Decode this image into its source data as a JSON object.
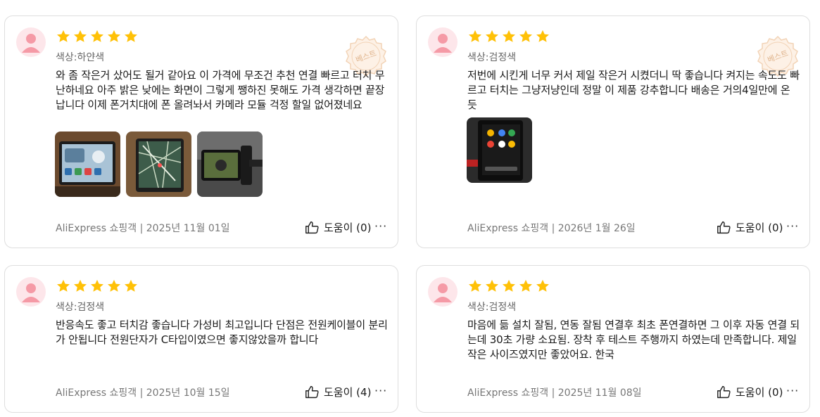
{
  "reviews": [
    {
      "stars": 5,
      "variant": "색상:하얀색",
      "text": "와 좀 작은거 샀어도 될거 같아요 이 가격에 무조건 추천 연결 빠르고 터치 무난하네요 아주 밝은 낮에는 화면이 그렇게 쨍하진 못해도 가격 생각하면 끝장납니다 이제 폰거치대에 폰 올려놔서 카메라 모듈 걱정 할일 없어졌네요",
      "badge": "베스트",
      "source": "AliExpress 쇼핑객",
      "date": "2025년 11월 01일",
      "helpful": "도움이 (0)",
      "photos": [
        "dashboard-photo-1",
        "map-photo",
        "camera-photo"
      ]
    },
    {
      "stars": 5,
      "variant": "색상:검정색",
      "text": "저번에 시킨게 너무 커서 제일 작은거 시켰더니 딱 좋습니다 켜지는 속도도 빠르고 터치는 그냥저냥인데 정말 이 제품 강추합니다 배송은 거의4일만에 온듯",
      "badge": "베스트",
      "source": "AliExpress 쇼핑객",
      "date": "2026년 1월 26일",
      "helpful": "도움이 (0)",
      "photos": [
        "apps-photo"
      ]
    },
    {
      "stars": 5,
      "variant": "색상:검정색",
      "text": "반응속도 좋고 터치감 좋습니다 가성비 최고입니다 단점은 전원케이블이 분리가 안됩니다 전원단자가 C타입이였으면 좋지않았을까 합니다",
      "source": "AliExpress 쇼핑객",
      "date": "2025년 10월 15일",
      "helpful": "도움이 (4)",
      "photos": []
    },
    {
      "stars": 5,
      "variant": "색상:검정색",
      "text": "마음에 듦 설치 잘됨, 연동 잘됨 연결후 최초 폰연결하면 그 이후 자동 연결 되는데 30초 가량 소요됨. 장착 후 테스트 주행까지 하였는데 만족합니다. 제일 작은 사이즈였지만 좋았어요. 한국",
      "source": "AliExpress 쇼핑객",
      "date": "2025년 11월 08일",
      "helpful": "도움이 (0)",
      "photos": []
    }
  ],
  "separator": "|",
  "colors": {
    "star": "#FFC107",
    "avatar_bg": "#FDE6EA",
    "avatar_fg": "#F59AA6",
    "border": "#DEDEDE"
  }
}
